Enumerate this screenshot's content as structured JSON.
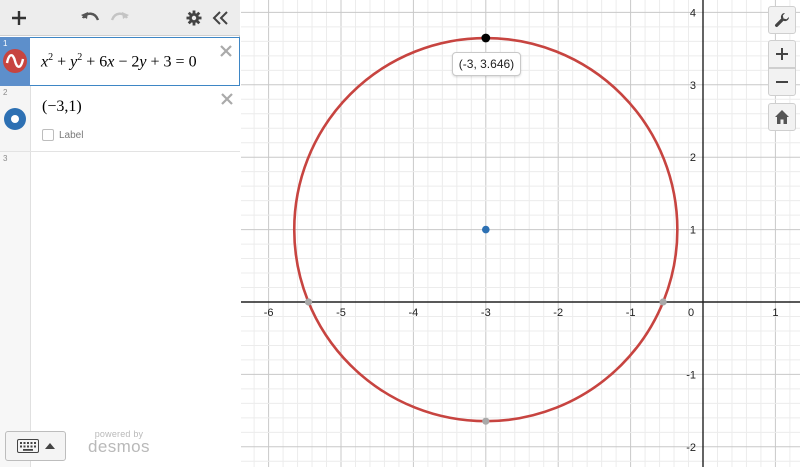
{
  "toolbar": {
    "add_icon": "plus-icon",
    "undo_icon": "undo-icon",
    "redo_icon": "redo-icon",
    "settings_icon": "gear-icon",
    "collapse_icon": "double-chevron-left-icon"
  },
  "expressions": [
    {
      "number": "1",
      "latex": "x² + y² + 6x − 2y + 3 = 0",
      "color": "#c74440",
      "icon": "wave-icon"
    },
    {
      "number": "2",
      "latex": "(−3,1)",
      "color": "#2d70b3",
      "icon": "point-icon",
      "label_checkbox": "Label"
    },
    {
      "number": "3",
      "latex": ""
    }
  ],
  "footer": {
    "powered_by": "powered by",
    "brand": "desmos"
  },
  "tooltip": {
    "text": "(-3, 3.646)"
  },
  "graph": {
    "x_ticks": [
      "-6",
      "-5",
      "-4",
      "-3",
      "-2",
      "-1",
      "0",
      "1"
    ],
    "y_ticks": [
      "4",
      "3",
      "2",
      "1",
      "-1",
      "-2"
    ],
    "circle": {
      "h": -3,
      "k": 1,
      "r": 2.6458,
      "color": "#c74440"
    },
    "center_point": {
      "x": -3,
      "y": 1,
      "color": "#2d70b3"
    },
    "top_point": {
      "x": -3,
      "y": 3.646,
      "color": "#000000"
    },
    "gray_points": [
      {
        "x": -5.449,
        "y": 0
      },
      {
        "x": -0.551,
        "y": 0
      },
      {
        "x": -3,
        "y": -1.646
      }
    ],
    "x_range": [
      -6.7,
      1.2
    ],
    "y_range": [
      -2.25,
      4.2
    ]
  },
  "side_controls": {
    "wrench_icon": "wrench-icon",
    "zoom_in_icon": "zoom-in-icon",
    "zoom_out_icon": "zoom-out-icon",
    "home_icon": "home-icon"
  }
}
